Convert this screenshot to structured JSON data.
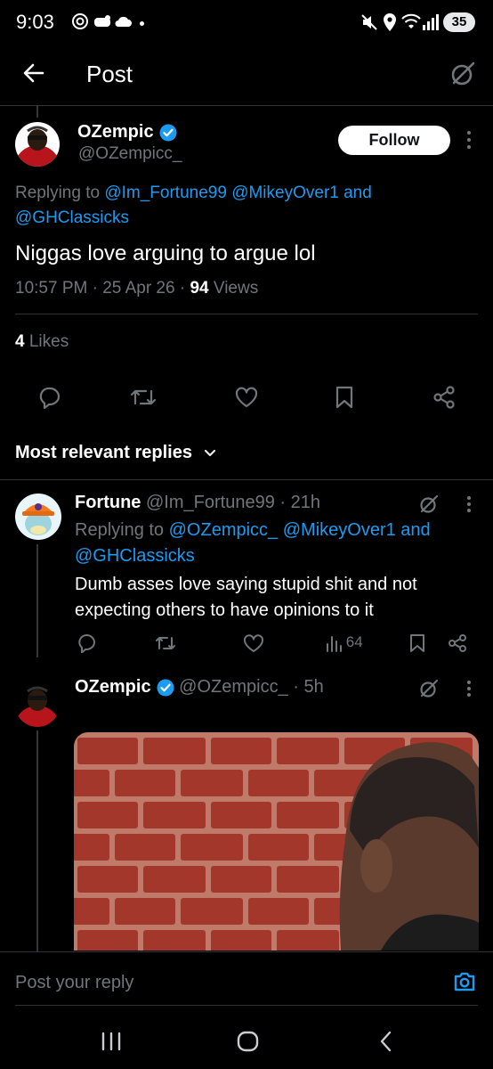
{
  "status_bar": {
    "time": "9:03",
    "battery": "35"
  },
  "header": {
    "title": "Post"
  },
  "post": {
    "display_name": "OZempic",
    "handle": "@OZempicc_",
    "follow_label": "Follow",
    "replying_prefix": "Replying to",
    "replying_line1": "@Im_Fortune99 @MikeyOver1 and",
    "replying_line2": "@GHClassicks",
    "text": "Niggas love arguing to argue lol",
    "time": "10:57 PM",
    "date": "25 Apr 26",
    "sep": "·",
    "views_count": "94",
    "views_label": "Views",
    "likes_count": "4",
    "likes_label": "Likes"
  },
  "replies_header": {
    "label": "Most relevant replies"
  },
  "reply1": {
    "display_name": "Fortune",
    "handle": "@Im_Fortune99",
    "age": "· 21h",
    "replying_prefix": "Replying to",
    "replying_line1": "@OZempicc_ @MikeyOver1 and",
    "replying_line2": "@GHClassicks",
    "text_line1": "Dumb asses love saying stupid shit and not",
    "text_line2": "expecting others to have opinions to it",
    "views": "64"
  },
  "reply2": {
    "display_name": "OZempic",
    "handle": "@OZempicc_",
    "age": "· 5h"
  },
  "composer": {
    "placeholder": "Post your reply"
  },
  "colors": {
    "accent": "#1d9bf0",
    "background": "#000000",
    "text": "#e7e9ea",
    "secondary": "#71767b",
    "divider": "#2f3336"
  }
}
